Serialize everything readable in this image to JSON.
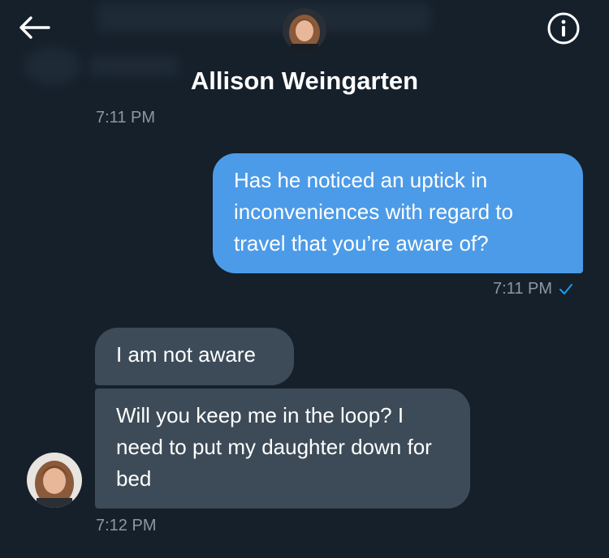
{
  "header": {
    "contact_name": "Allison Weingarten",
    "back_icon": "arrow-left-icon",
    "info_icon": "info-circle-icon"
  },
  "messages": [
    {
      "type": "timestamp",
      "text": "7:11 PM"
    },
    {
      "type": "sent",
      "text": "Has he noticed an uptick in inconveniences with regard to travel that you’re aware of?"
    },
    {
      "type": "timestamp",
      "text": "7:11 PM",
      "read_icon": "checkmark-icon"
    },
    {
      "type": "received",
      "text": "I am not aware"
    },
    {
      "type": "received",
      "text": "Will you keep me in the loop? I need to put my daughter down for bed"
    },
    {
      "type": "timestamp",
      "text": "7:12 PM"
    }
  ],
  "colors": {
    "background": "#15202b",
    "sent_bubble": "#4c9be8",
    "received_bubble": "#3d4b58",
    "timestamp": "#8b98a5",
    "accent": "#1d9bf0"
  }
}
